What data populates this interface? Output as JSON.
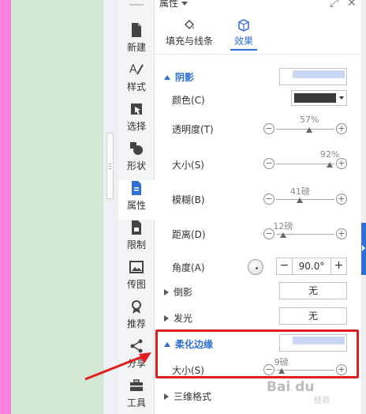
{
  "sidebar": {
    "items": [
      {
        "label": "新建",
        "icon": "document-icon"
      },
      {
        "label": "样式",
        "icon": "style-icon"
      },
      {
        "label": "选择",
        "icon": "cursor-icon"
      },
      {
        "label": "形状",
        "icon": "shapes-icon"
      },
      {
        "label": "属性",
        "icon": "properties-icon"
      },
      {
        "label": "限制",
        "icon": "restrict-icon"
      },
      {
        "label": "传图",
        "icon": "image-icon"
      },
      {
        "label": "推荐",
        "icon": "badge-icon"
      },
      {
        "label": "分享",
        "icon": "share-icon"
      },
      {
        "label": "工具",
        "icon": "toolbox-icon"
      }
    ],
    "active_index": 4
  },
  "panel": {
    "title": "属性",
    "tabs": [
      {
        "label": "填充与线条",
        "active": false
      },
      {
        "label": "效果",
        "active": true
      }
    ],
    "shadow": {
      "heading": "阴影",
      "color_label": "颜色(C)",
      "color_value": "#3a3a3a",
      "transparency": {
        "label": "透明度(T)",
        "display": "57%",
        "fraction": 0.57
      },
      "size": {
        "label": "大小(S)",
        "display": "92%",
        "fraction": 0.92
      },
      "blur": {
        "label": "模糊(B)",
        "display": "41磅",
        "fraction": 0.41
      },
      "distance": {
        "label": "距离(D)",
        "display": "12磅",
        "fraction": 0.12
      },
      "angle": {
        "label": "角度(A)",
        "value": "90.0°",
        "minus": "−",
        "plus": "+"
      }
    },
    "reflection": {
      "label": "倒影",
      "value": "无"
    },
    "glow": {
      "label": "发光",
      "value": "无"
    },
    "soft_edge": {
      "heading": "柔化边缘",
      "size": {
        "label": "大小(S)",
        "display": "9磅",
        "fraction": 0.09
      }
    },
    "three_d": {
      "label": "三维格式"
    }
  },
  "colors": {
    "accent": "#2f6fd6",
    "highlight": "#e02020",
    "annotation_arrow": "#e02020"
  },
  "watermark": {
    "text": "Bai du",
    "sub": "经验"
  }
}
